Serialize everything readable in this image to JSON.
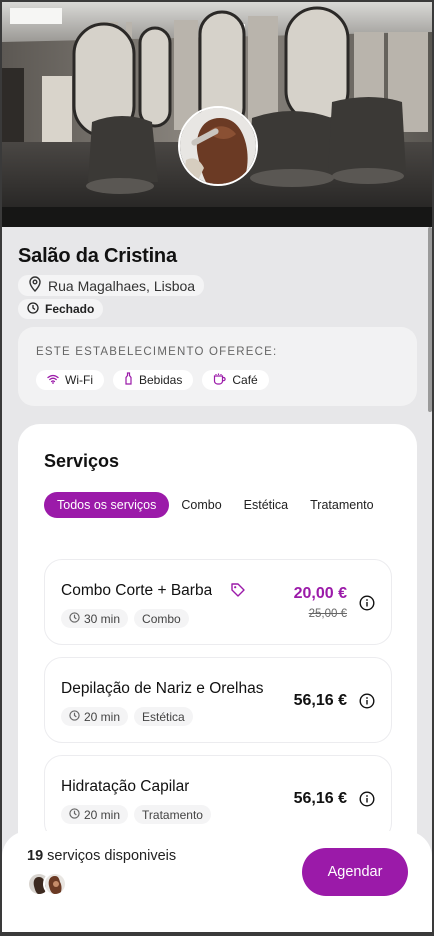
{
  "salon": {
    "name": "Salão da Cristina",
    "address": "Rua Magalhaes, Lisboa",
    "status": "Fechado"
  },
  "amenities": {
    "title": "ESTE ESTABELECIMENTO OFERECE:",
    "items": [
      {
        "label": "Wi-Fi",
        "icon": "wifi-icon"
      },
      {
        "label": "Bebidas",
        "icon": "bottle-icon"
      },
      {
        "label": "Café",
        "icon": "coffee-cup-icon"
      }
    ]
  },
  "services": {
    "title": "Serviços",
    "tabs": [
      "Todos os serviços",
      "Combo",
      "Estética",
      "Tratamento"
    ],
    "active_tab": 0,
    "items": [
      {
        "name": "Combo Corte + Barba",
        "duration": "30 min",
        "category": "Combo",
        "price": "20,00 €",
        "old_price": "25,00 €",
        "promo": true
      },
      {
        "name": "Depilação de Nariz e Orelhas",
        "duration": "20 min",
        "category": "Estética",
        "price": "56,16 €",
        "promo": false
      },
      {
        "name": "Hidratação Capilar",
        "duration": "20 min",
        "category": "Tratamento",
        "price": "56,16 €",
        "promo": false
      }
    ]
  },
  "footer": {
    "count": "19",
    "count_label": "serviços disponiveis",
    "book_label": "Agendar"
  },
  "colors": {
    "accent": "#9b1aa9"
  }
}
